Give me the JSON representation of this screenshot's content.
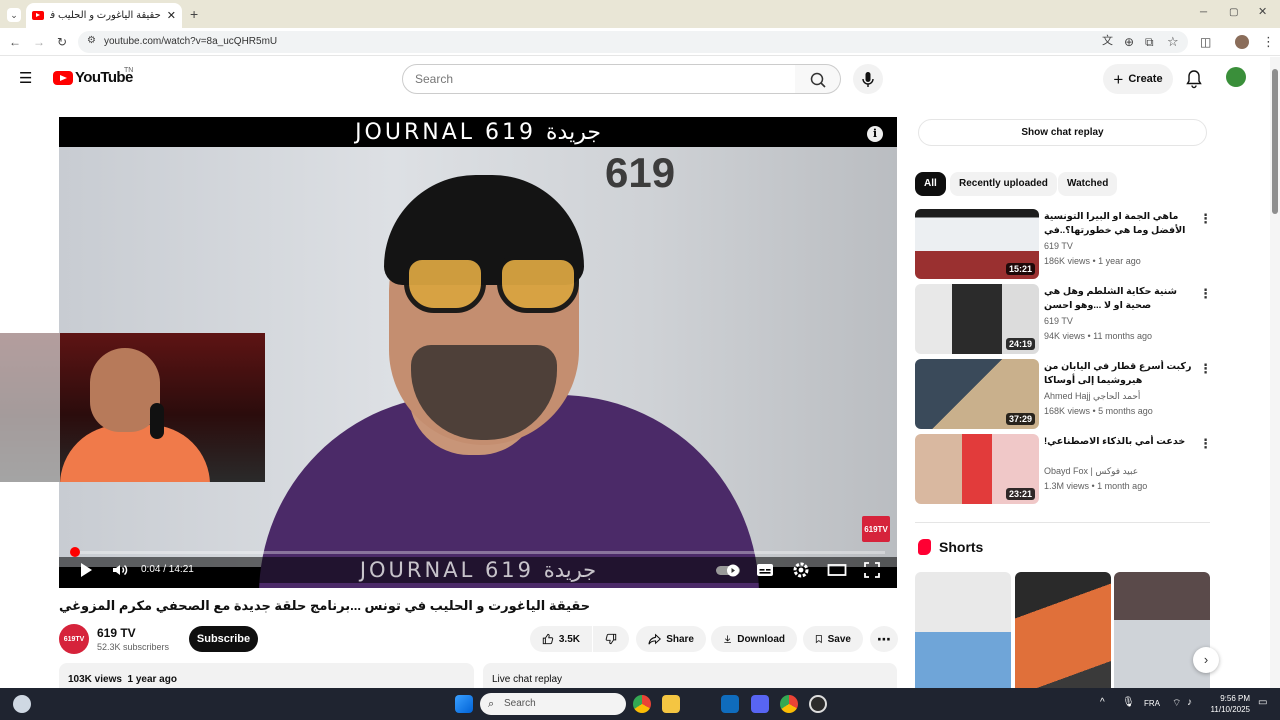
{
  "browser": {
    "tab_title": "حقيقة الياغورت و الحليب في تونس",
    "url": "youtube.com/watch?v=8a_ucQHR5mU"
  },
  "header": {
    "logo_text": "YouTube",
    "logo_tm": "TN",
    "search_placeholder": "Search",
    "create_label": "Create"
  },
  "player": {
    "banner_top": "JOURNAL 619 جريدة",
    "banner_bottom": "JOURNAL 619 جريدة",
    "whiteboard_text": "619",
    "badge_text": "619TV",
    "time": "0:04 / 14:21",
    "progress": 0.005
  },
  "video": {
    "title": "حقيقة الياغورت و الحليب في تونس ...برنامج حلقة جديدة مع الصحفي مكرم المزوغي",
    "channel": "619 TV",
    "channel_avatar_text": "619TV",
    "subscribers": "52.3K subscribers",
    "subscribe_label": "Subscribe",
    "likes": "3.5K",
    "share_label": "Share",
    "download_label": "Download",
    "save_label": "Save",
    "views_line": "103K views  1 year ago",
    "live_chat_label": "Live chat replay"
  },
  "sidebar": {
    "show_chat_replay": "Show chat replay",
    "chips": [
      "All",
      "Recently uploaded",
      "Watched"
    ],
    "recommendations": [
      {
        "title": "ماهي الجمة او البيرا التونسية الأفضل وما هي خطورتها؟..في حلقة جديدة مع الصحفي",
        "channel": "619 TV",
        "meta": "186K views • 1 year ago",
        "duration": "15:21"
      },
      {
        "title": "شنية حكاية الشلطم وهل هي صحية او لا ...وهو احسن منتوج..في برنامج حلقة جديدة مع",
        "channel": "619 TV",
        "meta": "94K views • 11 months ago",
        "duration": "24:19"
      },
      {
        "title": "ركبت أسرع قطار في اليابان من هيروشيما إلى أوساكا",
        "channel": "Ahmed Hajj أحمد الحاجي",
        "meta": "168K views • 5 months ago",
        "duration": "37:29"
      },
      {
        "title": "خدعت أمي بالذكاء الاصطناعي!",
        "channel": "Obayd Fox | عبيد فوكس",
        "meta": "1.3M views • 1 month ago",
        "duration": "23:21"
      }
    ],
    "shorts_title": "Shorts"
  },
  "taskbar": {
    "search_placeholder": "Search",
    "lang": "FRA",
    "time": "9:56 PM",
    "date": "11/10/2025"
  },
  "colors": {
    "youtube_red": "#ff0000",
    "subscribe_bg": "#0f0f0f",
    "chip_active_bg": "#0f0f0f",
    "taskbar_bg": "#1f2430"
  }
}
